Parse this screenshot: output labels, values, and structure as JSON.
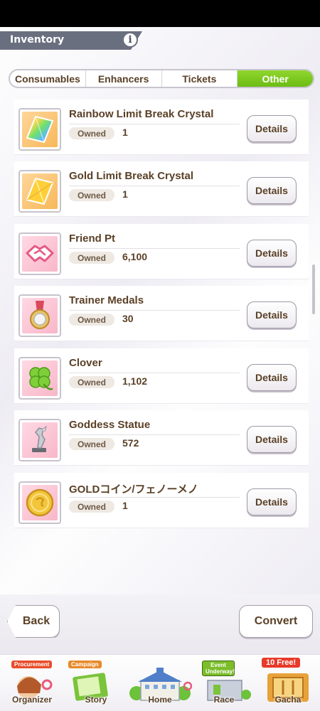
{
  "screen": {
    "title": "Inventory"
  },
  "tabs": [
    {
      "label": "Consumables",
      "active": false
    },
    {
      "label": "Enhancers",
      "active": false
    },
    {
      "label": "Tickets",
      "active": false
    },
    {
      "label": "Other",
      "active": true
    }
  ],
  "owned_label": "Owned",
  "details_label": "Details",
  "items": [
    {
      "name": "Rainbow Limit Break Crystal",
      "owned": "1",
      "icon": "rainbow-crystal-icon"
    },
    {
      "name": "Gold Limit Break Crystal",
      "owned": "1",
      "icon": "gold-crystal-icon"
    },
    {
      "name": "Friend Pt",
      "owned": "6,100",
      "icon": "handshake-icon"
    },
    {
      "name": "Trainer Medals",
      "owned": "30",
      "icon": "medal-icon"
    },
    {
      "name": "Clover",
      "owned": "1,102",
      "icon": "clover-icon"
    },
    {
      "name": "Goddess Statue",
      "owned": "572",
      "icon": "statue-icon"
    },
    {
      "name": "GOLDコイン/フェノーメノ",
      "owned": "1",
      "icon": "gold-coin-icon"
    }
  ],
  "buttons": {
    "back": "Back",
    "convert": "Convert"
  },
  "nav": [
    {
      "label": "Organizer",
      "tag": "Procurement",
      "tag_color": "#e84d2a"
    },
    {
      "label": "Story",
      "tag": "Campaign",
      "tag_color": "#e88a2a"
    },
    {
      "label": "Home",
      "tag": "",
      "tag_color": ""
    },
    {
      "label": "Race",
      "tag": "Event Underway!",
      "tag_color": "#7bbd2a"
    },
    {
      "label": "Gacha",
      "tag": "10 Free!",
      "tag_color": "#e83a2a"
    }
  ],
  "colors": {
    "accent_green": "#7ccb1f",
    "text_brown": "#5a4026",
    "header_gray": "#6a6f80"
  }
}
